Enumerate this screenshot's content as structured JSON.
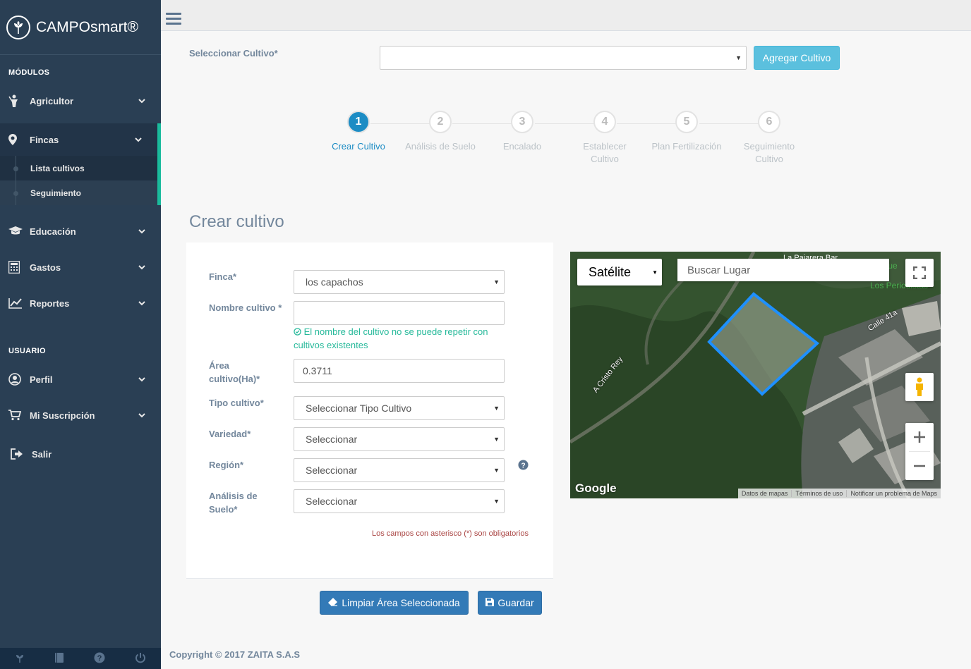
{
  "app": {
    "title": "CAMPOsmart®"
  },
  "sidebar": {
    "modules_title": "MÓDULOS",
    "user_title": "USUARIO",
    "items": [
      {
        "label": "Agricultor"
      },
      {
        "label": "Fincas"
      },
      {
        "label": "Educación"
      },
      {
        "label": "Gastos"
      },
      {
        "label": "Reportes"
      }
    ],
    "fincas_sub": [
      {
        "label": "Lista cultivos"
      },
      {
        "label": "Seguimiento"
      }
    ],
    "user_items": [
      {
        "label": "Perfil"
      },
      {
        "label": "Mi Suscripción"
      },
      {
        "label": "Salir"
      }
    ]
  },
  "top": {
    "select_label": "Seleccionar Cultivo*",
    "select_value": "",
    "add_button": "Agregar Cultivo"
  },
  "wizard": {
    "steps": [
      {
        "number": "1",
        "label": "Crear Cultivo",
        "label2": ""
      },
      {
        "number": "2",
        "label": "Análisis de Suelo",
        "label2": ""
      },
      {
        "number": "3",
        "label": "Encalado",
        "label2": ""
      },
      {
        "number": "4",
        "label": "Establecer",
        "label2": "Cultivo"
      },
      {
        "number": "5",
        "label": "Plan Fertilización",
        "label2": ""
      },
      {
        "number": "6",
        "label": "Seguimiento",
        "label2": "Cultivo"
      }
    ],
    "active_step": 1
  },
  "form": {
    "title": "Crear cultivo",
    "finca_label": "Finca*",
    "finca_value": "los capachos",
    "nombre_label": "Nombre cultivo *",
    "nombre_value": "",
    "nombre_help_1": "El nombre del cultivo no se puede repetir con",
    "nombre_help_2": "cultivos existentes",
    "area_label_1": "Área",
    "area_label_2": "cultivo(Ha)*",
    "area_value": "0.3711",
    "tipo_label": "Tipo cultivo*",
    "tipo_value": "Seleccionar Tipo Cultivo",
    "variedad_label": "Variedad*",
    "variedad_value": "Seleccionar",
    "region_label": "Región*",
    "region_value": "Seleccionar",
    "analisis_label_1": "Análisis de",
    "analisis_label_2": "Suelo*",
    "analisis_value": "Seleccionar",
    "required_note": "Los campos con asterisco (*) son obligatorios"
  },
  "buttons": {
    "clear": "Limpiar Área Seleccionada",
    "save": "Guardar"
  },
  "map": {
    "type": "Satélite",
    "search_placeholder": "Buscar Lugar",
    "logo": "Google",
    "footer": [
      "Datos de mapas",
      "Términos de uso",
      "Notificar un problema de Maps"
    ],
    "street_labels": [
      "A Cristo Rey",
      "Calle 41a"
    ]
  },
  "footer": {
    "copyright": "Copyright © 2017 ZAITA S.A.S"
  },
  "colors": {
    "sidebar_bg": "#2a3f54",
    "accent": "#1abb9c",
    "primary": "#337ab7",
    "info": "#5bc0de",
    "step_active": "#1c8cc4"
  }
}
